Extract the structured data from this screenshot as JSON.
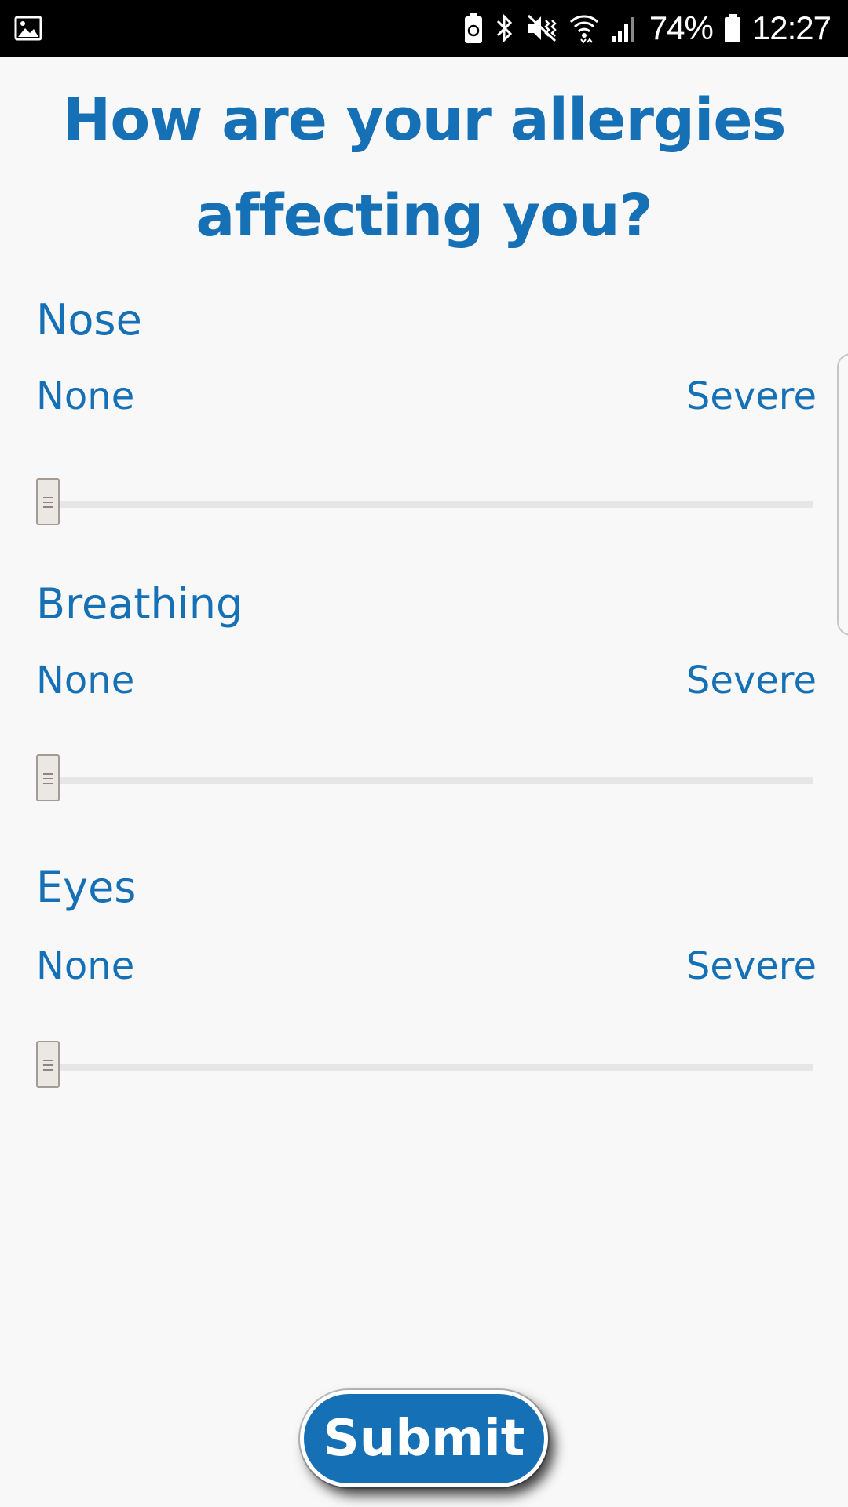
{
  "status_bar": {
    "left_icon": "image-notification-icon",
    "icons": [
      "battery-saver-icon",
      "bluetooth-icon",
      "mute-vibrate-icon",
      "wifi-icon",
      "signal-icon",
      "battery-icon"
    ],
    "battery": "74%",
    "time": "12:27"
  },
  "page": {
    "title": "How are your allergies affecting you?"
  },
  "sections": [
    {
      "title": "Nose",
      "min_label": "None",
      "max_label": "Severe",
      "value": 0
    },
    {
      "title": "Breathing",
      "min_label": "None",
      "max_label": "Severe",
      "value": 0
    },
    {
      "title": "Eyes",
      "min_label": "None",
      "max_label": "Severe",
      "value": 0
    }
  ],
  "submit": {
    "label": "Submit"
  },
  "colors": {
    "accent": "#1670b6",
    "background": "#f8f8f8",
    "track": "#e6e6e6",
    "thumb": "#ebe7e2"
  }
}
